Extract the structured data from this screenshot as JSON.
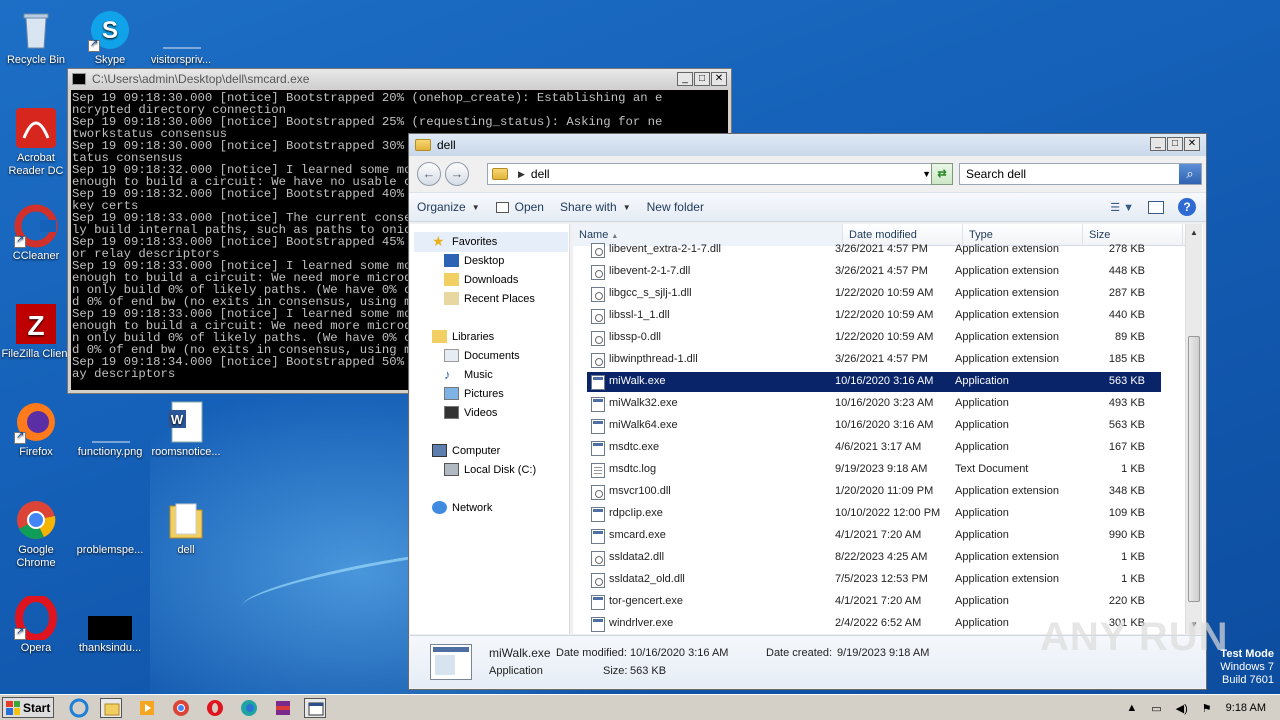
{
  "desktop": {
    "icons": [
      {
        "label": "Recycle Bin"
      },
      {
        "label": "Skype"
      },
      {
        "label": "visitorspriv..."
      },
      {
        "label": "Acrobat Reader DC"
      },
      {
        "label": "CCleaner"
      },
      {
        "label": "FileZilla Client"
      },
      {
        "label": "Firefox"
      },
      {
        "label": "functiony.png"
      },
      {
        "label": "roomsnotice..."
      },
      {
        "label": "Google Chrome"
      },
      {
        "label": "problemspe..."
      },
      {
        "label": "dell"
      },
      {
        "label": "Opera"
      },
      {
        "label": "thanksindu..."
      }
    ]
  },
  "console": {
    "title": "C:\\Users\\admin\\Desktop\\dell\\smcard.exe",
    "output": "Sep 19 09:18:30.000 [notice] Bootstrapped 20% (onehop_create): Establishing an e\nncrypted directory connection\nSep 19 09:18:30.000 [notice] Bootstrapped 25% (requesting_status): Asking for ne\ntworkstatus consensus\nSep 19 09:18:30.000 [notice] Bootstrapped 30% (loading_status): Loading networks\ntatus consensus\nSep 19 09:18:32.000 [notice] I learned some more directory information, but not\nenough to build a circuit: We have no usable consensus.\nSep 19 09:18:32.000 [notice] Bootstrapped 40% (loading_keys): Loading authority\nkey certs\nSep 19 09:18:33.000 [notice] The current consensus has no exit nodes. Tor can on\nly build internal paths, such as paths to onion services.\nSep 19 09:18:33.000 [notice] Bootstrapped 45% (requesting_descriptors): Asking f\nor relay descriptors\nSep 19 09:18:33.000 [notice] I learned some more directory information, but not\nenough to build a circuit: We need more microdescriptors: we have 0/1, and ca\nn only build 0% of likely paths. (We have 0% of guards bw, 0% of midpoint bw, an\nd 0% of end bw (no exits in consensus, using mid) = 0% of path bw.)\nSep 19 09:18:33.000 [notice] I learned some more directory information, but not\nenough to build a circuit: We need more microdescriptors: we have 0/1, and ca\nn only build 0% of likely paths. (We have 0% of guards bw, 0% of midpoint bw, an\nd 0% of end bw (no exits in consensus, using mid) = 0% of path bw.)\nSep 19 09:18:34.000 [notice] Bootstrapped 50% (loading_descriptors): Loading rel\nay descriptors"
  },
  "explorer": {
    "title": "dell",
    "address": "dell",
    "search_placeholder": "Search dell",
    "toolbar": {
      "organize": "Organize",
      "open": "Open",
      "share_with": "Share with",
      "new_folder": "New folder"
    },
    "nav": {
      "favorites": "Favorites",
      "desktop": "Desktop",
      "downloads": "Downloads",
      "recent_places": "Recent Places",
      "libraries": "Libraries",
      "documents": "Documents",
      "music": "Music",
      "pictures": "Pictures",
      "videos": "Videos",
      "computer": "Computer",
      "local_disk": "Local Disk (C:)",
      "network": "Network"
    },
    "columns": {
      "name": "Name",
      "date": "Date modified",
      "type": "Type",
      "size": "Size"
    },
    "files": [
      {
        "name": "libevent_extra-2-1-7.dll",
        "date": "3/26/2021 4:57 PM",
        "type": "Application extension",
        "size": "278 KB",
        "icon": "dll"
      },
      {
        "name": "libevent-2-1-7.dll",
        "date": "3/26/2021 4:57 PM",
        "type": "Application extension",
        "size": "448 KB",
        "icon": "dll"
      },
      {
        "name": "libgcc_s_sjlj-1.dll",
        "date": "1/22/2020 10:59 AM",
        "type": "Application extension",
        "size": "287 KB",
        "icon": "dll"
      },
      {
        "name": "libssl-1_1.dll",
        "date": "1/22/2020 10:59 AM",
        "type": "Application extension",
        "size": "440 KB",
        "icon": "dll"
      },
      {
        "name": "libssp-0.dll",
        "date": "1/22/2020 10:59 AM",
        "type": "Application extension",
        "size": "89 KB",
        "icon": "dll"
      },
      {
        "name": "libwinpthread-1.dll",
        "date": "3/26/2021 4:57 PM",
        "type": "Application extension",
        "size": "185 KB",
        "icon": "dll"
      },
      {
        "name": "miWalk.exe",
        "date": "10/16/2020 3:16 AM",
        "type": "Application",
        "size": "563 KB",
        "icon": "app",
        "selected": true
      },
      {
        "name": "miWalk32.exe",
        "date": "10/16/2020 3:23 AM",
        "type": "Application",
        "size": "493 KB",
        "icon": "app"
      },
      {
        "name": "miWalk64.exe",
        "date": "10/16/2020 3:16 AM",
        "type": "Application",
        "size": "563 KB",
        "icon": "app"
      },
      {
        "name": "msdtc.exe",
        "date": "4/6/2021 3:17 AM",
        "type": "Application",
        "size": "167 KB",
        "icon": "app"
      },
      {
        "name": "msdtc.log",
        "date": "9/19/2023 9:18 AM",
        "type": "Text Document",
        "size": "1 KB",
        "icon": "txt"
      },
      {
        "name": "msvcr100.dll",
        "date": "1/20/2020 11:09 PM",
        "type": "Application extension",
        "size": "348 KB",
        "icon": "dll"
      },
      {
        "name": "rdpcIip.exe",
        "date": "10/10/2022 12:00 PM",
        "type": "Application",
        "size": "109 KB",
        "icon": "app"
      },
      {
        "name": "smcard.exe",
        "date": "4/1/2021 7:20 AM",
        "type": "Application",
        "size": "990 KB",
        "icon": "app"
      },
      {
        "name": "ssldata2.dll",
        "date": "8/22/2023 4:25 AM",
        "type": "Application extension",
        "size": "1 KB",
        "icon": "dll"
      },
      {
        "name": "ssldata2_old.dll",
        "date": "7/5/2023 12:53 PM",
        "type": "Application extension",
        "size": "1 KB",
        "icon": "dll"
      },
      {
        "name": "tor-gencert.exe",
        "date": "4/1/2021 7:20 AM",
        "type": "Application",
        "size": "220 KB",
        "icon": "app"
      },
      {
        "name": "windrlver.exe",
        "date": "2/4/2022 6:52 AM",
        "type": "Application",
        "size": "301 KB",
        "icon": "app"
      }
    ],
    "details": {
      "name": "miWalk.exe",
      "modified_label": "Date modified:",
      "modified": "10/16/2020 3:16 AM",
      "created_label": "Date created:",
      "created": "9/19/2023 9:18 AM",
      "type": "Application",
      "size_label": "Size:",
      "size": "563 KB"
    }
  },
  "taskbar": {
    "start": "Start",
    "clock": "9:18 AM"
  },
  "watermark": "ANY RUN",
  "testmode": {
    "line1": "Test Mode",
    "line2": "Windows 7",
    "line3": "Build 7601"
  }
}
